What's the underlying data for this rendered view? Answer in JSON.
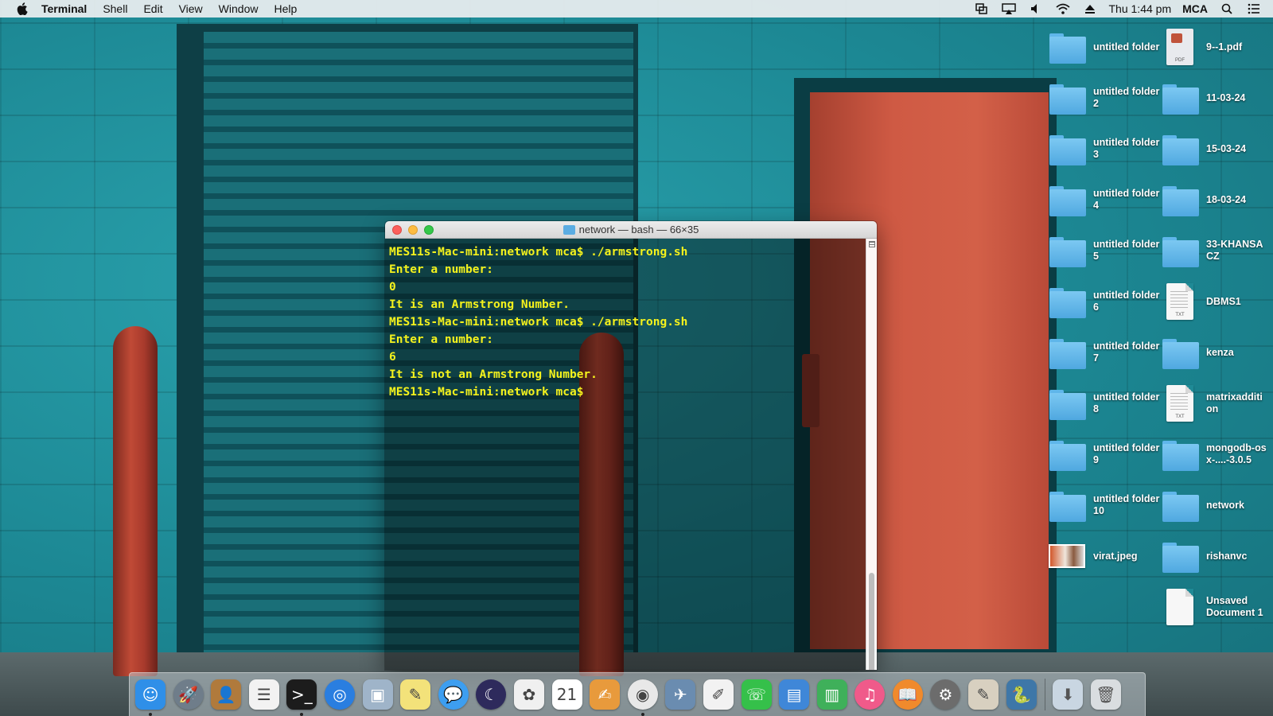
{
  "menubar": {
    "app_name": "Terminal",
    "menus": [
      "Shell",
      "Edit",
      "View",
      "Window",
      "Help"
    ],
    "clock": "Thu 1:44 pm",
    "user": "MCA",
    "status_icons": [
      "mirroring-icon",
      "airplay-icon",
      "volume-icon",
      "wifi-icon",
      "eject-icon"
    ]
  },
  "desktop": {
    "col1": [
      {
        "label": "untitled folder",
        "type": "folder"
      },
      {
        "label": "untitled folder 2",
        "type": "folder"
      },
      {
        "label": "untitled folder 3",
        "type": "folder"
      },
      {
        "label": "untitled folder 4",
        "type": "folder"
      },
      {
        "label": "untitled folder 5",
        "type": "folder"
      },
      {
        "label": "untitled folder 6",
        "type": "folder"
      },
      {
        "label": "untitled folder 7",
        "type": "folder"
      },
      {
        "label": "untitled folder 8",
        "type": "folder"
      },
      {
        "label": "untitled folder 9",
        "type": "folder"
      },
      {
        "label": "untitled folder 10",
        "type": "folder"
      },
      {
        "label": "virat.jpeg",
        "type": "image"
      }
    ],
    "col2": [
      {
        "label": "9--1.pdf",
        "type": "pdf",
        "tag": "PDF"
      },
      {
        "label": "11-03-24",
        "type": "folder"
      },
      {
        "label": "15-03-24",
        "type": "folder"
      },
      {
        "label": "18-03-24",
        "type": "folder"
      },
      {
        "label": "33-KHANSA CZ",
        "type": "folder"
      },
      {
        "label": "DBMS1",
        "type": "doc",
        "tag": "TXT"
      },
      {
        "label": "kenza",
        "type": "folder"
      },
      {
        "label": "matrixaddition",
        "type": "doc",
        "tag": "TXT"
      },
      {
        "label": "mongodb-osx-....-3.0.5",
        "type": "folder"
      },
      {
        "label": "network",
        "type": "folder"
      },
      {
        "label": "rishanvc",
        "type": "folder"
      },
      {
        "label": "Unsaved Document 1",
        "type": "doc",
        "tag": ""
      }
    ]
  },
  "terminal": {
    "title": "network — bash — 66×35",
    "lines": [
      "MES11s-Mac-mini:network mca$ ./armstrong.sh",
      "Enter a number:",
      "0",
      "It is an Armstrong Number.",
      "MES11s-Mac-mini:network mca$ ./armstrong.sh",
      "Enter a number:",
      "6",
      "It is not an Armstrong Number.",
      "MES11s-Mac-mini:network mca$"
    ]
  },
  "dock": {
    "items": [
      {
        "name": "finder",
        "glyph": "☺",
        "color": "#2f8fe8",
        "running": true
      },
      {
        "name": "launchpad",
        "glyph": "🚀",
        "color": "#6f7d8a",
        "running": false
      },
      {
        "name": "contacts",
        "glyph": "👤",
        "color": "#b07a3c",
        "running": false
      },
      {
        "name": "reminders",
        "glyph": "☰",
        "color": "#f2f2f2",
        "running": false
      },
      {
        "name": "terminal",
        "glyph": ">_",
        "color": "#1c1c1c",
        "running": true
      },
      {
        "name": "safari",
        "glyph": "◎",
        "color": "#2a7ee0",
        "running": false
      },
      {
        "name": "preview",
        "glyph": "▣",
        "color": "#9fb4c9",
        "running": false
      },
      {
        "name": "notes",
        "glyph": "✎",
        "color": "#f3e27a",
        "running": false
      },
      {
        "name": "messages",
        "glyph": "💬",
        "color": "#3d9ef0",
        "running": false
      },
      {
        "name": "eclipse",
        "glyph": "☾",
        "color": "#2e2a5c",
        "running": false
      },
      {
        "name": "photos",
        "glyph": "✿",
        "color": "#f0f0f0",
        "running": false
      },
      {
        "name": "calendar",
        "glyph": "21",
        "color": "#ffffff",
        "running": false
      },
      {
        "name": "textedit-pages",
        "glyph": "✍",
        "color": "#e89a3c",
        "running": false
      },
      {
        "name": "chrome",
        "glyph": "◉",
        "color": "#e8e8e8",
        "running": true
      },
      {
        "name": "preview-photo",
        "glyph": "✈",
        "color": "#6a8cb0",
        "running": false
      },
      {
        "name": "textedit",
        "glyph": "✐",
        "color": "#f2f2f2",
        "running": false
      },
      {
        "name": "facetime",
        "glyph": "☏",
        "color": "#35c04a",
        "running": false
      },
      {
        "name": "keynote",
        "glyph": "▤",
        "color": "#3f87d8",
        "running": false
      },
      {
        "name": "numbers",
        "glyph": "▥",
        "color": "#3fb05a",
        "running": false
      },
      {
        "name": "itunes",
        "glyph": "♫",
        "color": "#f05a8a",
        "running": false
      },
      {
        "name": "ibooks",
        "glyph": "📖",
        "color": "#f08a2c",
        "running": false
      },
      {
        "name": "system-preferences",
        "glyph": "⚙",
        "color": "#6c6c6c",
        "running": false
      },
      {
        "name": "script-editor",
        "glyph": "✎",
        "color": "#d8d0c0",
        "running": false
      },
      {
        "name": "python-launcher",
        "glyph": "🐍",
        "color": "#3e77a8",
        "running": false
      }
    ],
    "right_items": [
      {
        "name": "downloads-stack",
        "glyph": "⬇",
        "color": "#c9d6e2"
      },
      {
        "name": "trash",
        "glyph": "🗑",
        "color": "#d9dde0"
      }
    ]
  }
}
